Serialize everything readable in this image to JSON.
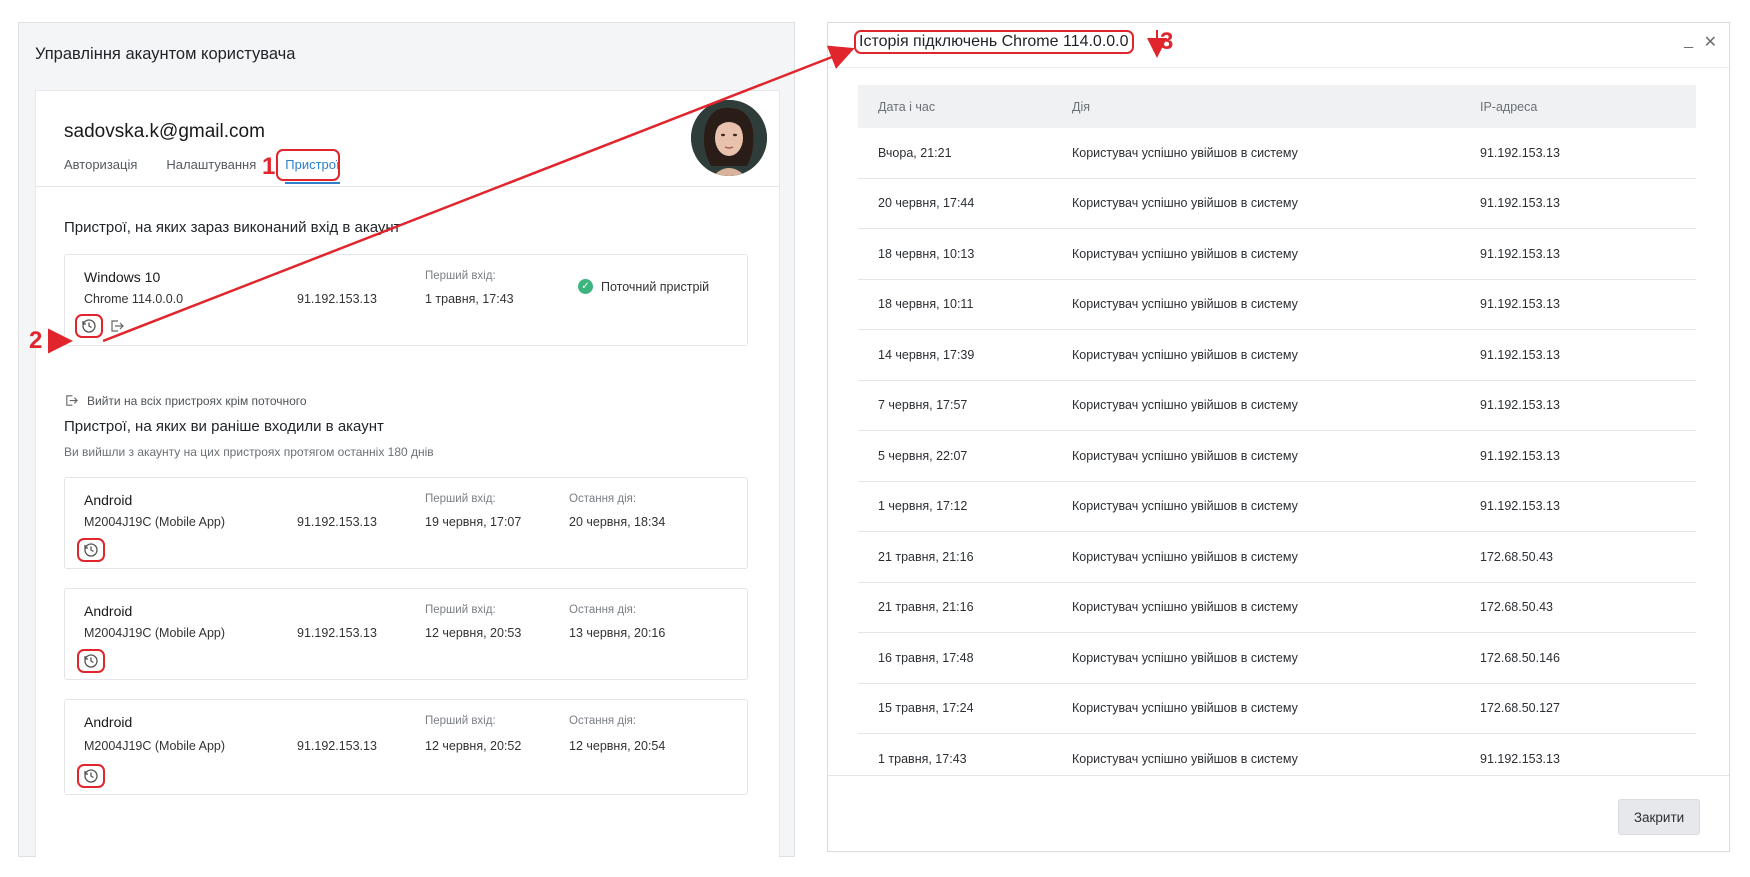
{
  "left": {
    "title": "Управління акаунтом користувача",
    "email": "sadovska.k@gmail.com",
    "tabs": [
      {
        "label": "Авторизація"
      },
      {
        "label": "Налаштування"
      },
      {
        "label": "Пристрої"
      }
    ],
    "current_section_title": "Пристрої, на яких зараз виконаний вхід в акаунт",
    "current_device": {
      "name": "Windows 10",
      "model": "Chrome 114.0.0.0",
      "ip": "91.192.153.13",
      "first_login_label": "Перший вхід:",
      "first_login": "1 травня, 17:43",
      "current_label": "Поточний пристрій"
    },
    "logout_all_label": "Вийти на всіх пристроях крім поточного",
    "previous_section_title": "Пристрої, на яких ви раніше входили в акаунт",
    "previous_section_sub": "Ви вийшли з акаунту на цих пристроях протягом останніх 180 днів",
    "previous_devices": [
      {
        "name": "Android",
        "model": "M2004J19C (Mobile App)",
        "ip": "91.192.153.13",
        "first_label": "Перший вхід:",
        "first": "19 червня, 17:07",
        "last_label": "Остання дія:",
        "last": "20 червня, 18:34"
      },
      {
        "name": "Android",
        "model": "M2004J19C (Mobile App)",
        "ip": "91.192.153.13",
        "first_label": "Перший вхід:",
        "first": "12 червня, 20:53",
        "last_label": "Остання дія:",
        "last": "13 червня, 20:16"
      },
      {
        "name": "Android",
        "model": "M2004J19C (Mobile App)",
        "ip": "91.192.153.13",
        "first_label": "Перший вхід:",
        "first": "12 червня, 20:52",
        "last_label": "Остання дія:",
        "last": "12 червня, 20:54"
      }
    ]
  },
  "annotations": {
    "m1": "1",
    "m2": "2",
    "m3": "3",
    "color": "#e0262c"
  },
  "modal": {
    "title": "Історія підключень Chrome 114.0.0.0",
    "minimize": "_",
    "close": "✕",
    "columns": [
      "Дата і час",
      "Дія",
      "IP-адреса"
    ],
    "rows": [
      [
        "Вчора, 21:21",
        "Користувач успішно увійшов в систему",
        "91.192.153.13"
      ],
      [
        "20 червня, 17:44",
        "Користувач успішно увійшов в систему",
        "91.192.153.13"
      ],
      [
        "18 червня, 10:13",
        "Користувач успішно увійшов в систему",
        "91.192.153.13"
      ],
      [
        "18 червня, 10:11",
        "Користувач успішно увійшов в систему",
        "91.192.153.13"
      ],
      [
        "14 червня, 17:39",
        "Користувач успішно увійшов в систему",
        "91.192.153.13"
      ],
      [
        "7 червня, 17:57",
        "Користувач успішно увійшов в систему",
        "91.192.153.13"
      ],
      [
        "5 червня, 22:07",
        "Користувач успішно увійшов в систему",
        "91.192.153.13"
      ],
      [
        "1 червня, 17:12",
        "Користувач успішно увійшов в систему",
        "91.192.153.13"
      ],
      [
        "21 травня, 21:16",
        "Користувач успішно увійшов в систему",
        "172.68.50.43"
      ],
      [
        "21 травня, 21:16",
        "Користувач успішно увійшов в систему",
        "172.68.50.43"
      ],
      [
        "16 травня, 17:48",
        "Користувач успішно увійшов в систему",
        "172.68.50.146"
      ],
      [
        "15 травня, 17:24",
        "Користувач успішно увійшов в систему",
        "172.68.50.127"
      ],
      [
        "1 травня, 17:43",
        "Користувач успішно увійшов в систему",
        "91.192.153.13"
      ]
    ],
    "close_button": "Закрити"
  },
  "colors": {
    "accent": "#2f80c9",
    "annotation": "#e0262c",
    "success": "#3bb57d"
  }
}
